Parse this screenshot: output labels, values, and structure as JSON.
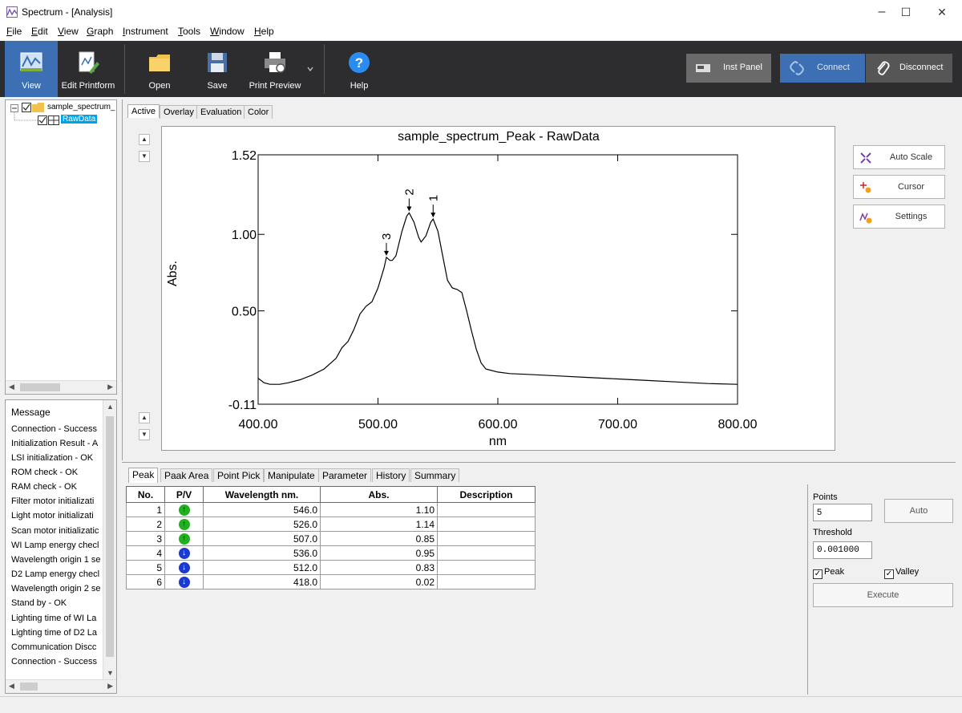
{
  "window": {
    "title": "Spectrum - [Analysis]",
    "controls": {
      "minimize": "–",
      "maximize": "☐",
      "close": "✕"
    }
  },
  "menu": [
    "File",
    "Edit",
    "View",
    "Graph",
    "Instrument",
    "Tools",
    "Window",
    "Help"
  ],
  "toolbar": {
    "view": "View",
    "edit_printform": "Edit Printform",
    "open": "Open",
    "save": "Save",
    "print_preview": "Print Preview",
    "help": "Help",
    "inst_panel": "Inst Panel",
    "connect": "Connect",
    "disconnect": "Disconnect"
  },
  "tree": {
    "root": "sample_spectrum_",
    "child": "RawData"
  },
  "messages": {
    "header": "Message",
    "items": [
      "Connection - Success",
      "Initialization Result - A",
      "LSI initialization - OK",
      "ROM check - OK",
      "RAM check - OK",
      "Filter motor initializati",
      "Light motor initializati",
      "Scan motor initializatic",
      "WI Lamp energy checl",
      "Wavelength origin 1 se",
      "D2 Lamp energy checl",
      "Wavelength origin 2 se",
      "Stand by - OK",
      "Lighting time of WI La",
      "Lighting time of D2 La",
      "Communication Discc",
      "Connection - Success"
    ]
  },
  "top_tabs": [
    "Active",
    "Overlay",
    "Evaluation",
    "Color"
  ],
  "side_buttons": {
    "auto_scale": "Auto Scale",
    "cursor": "Cursor",
    "settings": "Settings"
  },
  "chart_data": {
    "type": "line",
    "title": "sample_spectrum_Peak - RawData",
    "xlabel": "nm",
    "ylabel": "Abs.",
    "xlim": [
      400,
      800
    ],
    "ylim": [
      -0.11,
      1.52
    ],
    "xticks": [
      "400.00",
      "500.00",
      "600.00",
      "700.00",
      "800.00"
    ],
    "yticks": [
      "1.52",
      "1.00",
      "0.50",
      "-0.11"
    ],
    "series": [
      {
        "x": [
          400,
          405,
          410,
          415,
          418,
          425,
          435,
          445,
          455,
          465,
          470,
          475,
          480,
          485,
          490,
          495,
          500,
          505,
          507,
          510,
          512,
          515,
          520,
          524,
          526,
          530,
          534,
          536,
          540,
          544,
          546,
          550,
          554,
          558,
          562,
          566,
          570,
          574,
          578,
          582,
          586,
          590,
          595,
          600,
          610,
          625,
          650,
          675,
          700,
          725,
          750,
          775,
          800
        ],
        "y": [
          0.06,
          0.03,
          0.02,
          0.02,
          0.02,
          0.03,
          0.05,
          0.08,
          0.12,
          0.19,
          0.26,
          0.3,
          0.38,
          0.48,
          0.53,
          0.56,
          0.65,
          0.78,
          0.85,
          0.83,
          0.83,
          0.86,
          1.02,
          1.12,
          1.14,
          1.08,
          0.98,
          0.95,
          0.99,
          1.08,
          1.1,
          1.02,
          0.86,
          0.7,
          0.65,
          0.64,
          0.62,
          0.5,
          0.37,
          0.25,
          0.16,
          0.12,
          0.11,
          0.1,
          0.09,
          0.085,
          0.075,
          0.065,
          0.055,
          0.045,
          0.035,
          0.025,
          0.02
        ]
      }
    ],
    "annotations": [
      {
        "label": "1",
        "x": 546,
        "y": 1.1
      },
      {
        "label": "2",
        "x": 526,
        "y": 1.14
      },
      {
        "label": "3",
        "x": 507,
        "y": 0.85
      }
    ],
    "grid": false
  },
  "bottom_tabs": [
    "Peak",
    "Paak Area",
    "Point Pick",
    "Manipulate",
    "Parameter",
    "History",
    "Summary"
  ],
  "peak_table": {
    "columns": [
      "No.",
      "P/V",
      "Wavelength nm.",
      "Abs.",
      "Description"
    ],
    "rows": [
      {
        "no": "1",
        "pv": "peak",
        "wavelength": "546.0",
        "abs": "1.10",
        "desc": ""
      },
      {
        "no": "2",
        "pv": "peak",
        "wavelength": "526.0",
        "abs": "1.14",
        "desc": ""
      },
      {
        "no": "3",
        "pv": "peak",
        "wavelength": "507.0",
        "abs": "0.85",
        "desc": ""
      },
      {
        "no": "4",
        "pv": "valley",
        "wavelength": "536.0",
        "abs": "0.95",
        "desc": ""
      },
      {
        "no": "5",
        "pv": "valley",
        "wavelength": "512.0",
        "abs": "0.83",
        "desc": ""
      },
      {
        "no": "6",
        "pv": "valley",
        "wavelength": "418.0",
        "abs": "0.02",
        "desc": ""
      }
    ]
  },
  "params": {
    "points_label": "Points",
    "points_value": "5",
    "auto": "Auto",
    "threshold_label": "Threshold",
    "threshold_value": "0.001000",
    "peak_label": "Peak",
    "peak_checked": true,
    "valley_label": "Valley",
    "valley_checked": true,
    "execute": "Execute"
  },
  "colors": {
    "toolbar_bg": "#2d2d30",
    "active_tool": "#3c6fb4",
    "connect_bg": "#3c6fb4",
    "peak_icon": "#22b022",
    "valley_icon": "#1a3ad0",
    "tree_selection": "#00a2e8"
  }
}
